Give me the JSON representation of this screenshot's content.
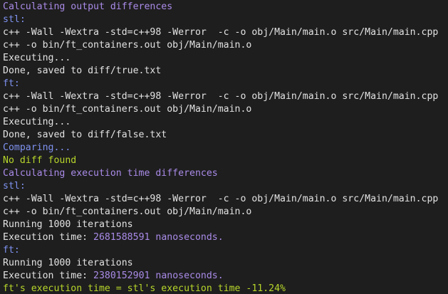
{
  "colors": {
    "background": "#1e1e1e",
    "default_text": "#e2e2e2",
    "heading_purple": "#a98be8",
    "label_blue": "#7f92f0",
    "success_green": "#b6d62a"
  },
  "terminal": {
    "lines": [
      {
        "segments": [
          {
            "text": "Calculating output differences",
            "color": "purple"
          }
        ]
      },
      {
        "segments": [
          {
            "text": "stl:",
            "color": "blue"
          }
        ]
      },
      {
        "segments": [
          {
            "text": "c++ -Wall -Wextra -std=c++98 -Werror  -c -o obj/Main/main.o src/Main/main.cpp",
            "color": "white"
          }
        ]
      },
      {
        "segments": [
          {
            "text": "c++ -o bin/ft_containers.out obj/Main/main.o",
            "color": "white"
          }
        ]
      },
      {
        "segments": [
          {
            "text": "Executing...",
            "color": "white"
          }
        ]
      },
      {
        "segments": [
          {
            "text": "Done, saved to diff/true.txt",
            "color": "white"
          }
        ]
      },
      {
        "segments": [
          {
            "text": "ft:",
            "color": "blue"
          }
        ]
      },
      {
        "segments": [
          {
            "text": "c++ -Wall -Wextra -std=c++98 -Werror  -c -o obj/Main/main.o src/Main/main.cpp",
            "color": "white"
          }
        ]
      },
      {
        "segments": [
          {
            "text": "c++ -o bin/ft_containers.out obj/Main/main.o",
            "color": "white"
          }
        ]
      },
      {
        "segments": [
          {
            "text": "Executing...",
            "color": "white"
          }
        ]
      },
      {
        "segments": [
          {
            "text": "Done, saved to diff/false.txt",
            "color": "white"
          }
        ]
      },
      {
        "segments": [
          {
            "text": "Comparing...",
            "color": "blue"
          }
        ]
      },
      {
        "segments": [
          {
            "text": "No diff found",
            "color": "green"
          }
        ]
      },
      {
        "segments": [
          {
            "text": "Calculating execution time differences",
            "color": "purple"
          }
        ]
      },
      {
        "segments": [
          {
            "text": "stl:",
            "color": "blue"
          }
        ]
      },
      {
        "segments": [
          {
            "text": "c++ -Wall -Wextra -std=c++98 -Werror  -c -o obj/Main/main.o src/Main/main.cpp",
            "color": "white"
          }
        ]
      },
      {
        "segments": [
          {
            "text": "c++ -o bin/ft_containers.out obj/Main/main.o",
            "color": "white"
          }
        ]
      },
      {
        "segments": [
          {
            "text": "Running 1000 iterations",
            "color": "white"
          }
        ]
      },
      {
        "segments": [
          {
            "text": "Execution time: ",
            "color": "white"
          },
          {
            "text": "2681588591 nanoseconds.",
            "color": "purple"
          }
        ]
      },
      {
        "segments": [
          {
            "text": "ft:",
            "color": "blue"
          }
        ]
      },
      {
        "segments": [
          {
            "text": "Running 1000 iterations",
            "color": "white"
          }
        ]
      },
      {
        "segments": [
          {
            "text": "Execution time: ",
            "color": "white"
          },
          {
            "text": "2380152901 nanoseconds.",
            "color": "purple"
          }
        ]
      },
      {
        "segments": [
          {
            "text": "ft's execution time = stl's execution time -11.24%",
            "color": "green"
          }
        ]
      }
    ]
  }
}
